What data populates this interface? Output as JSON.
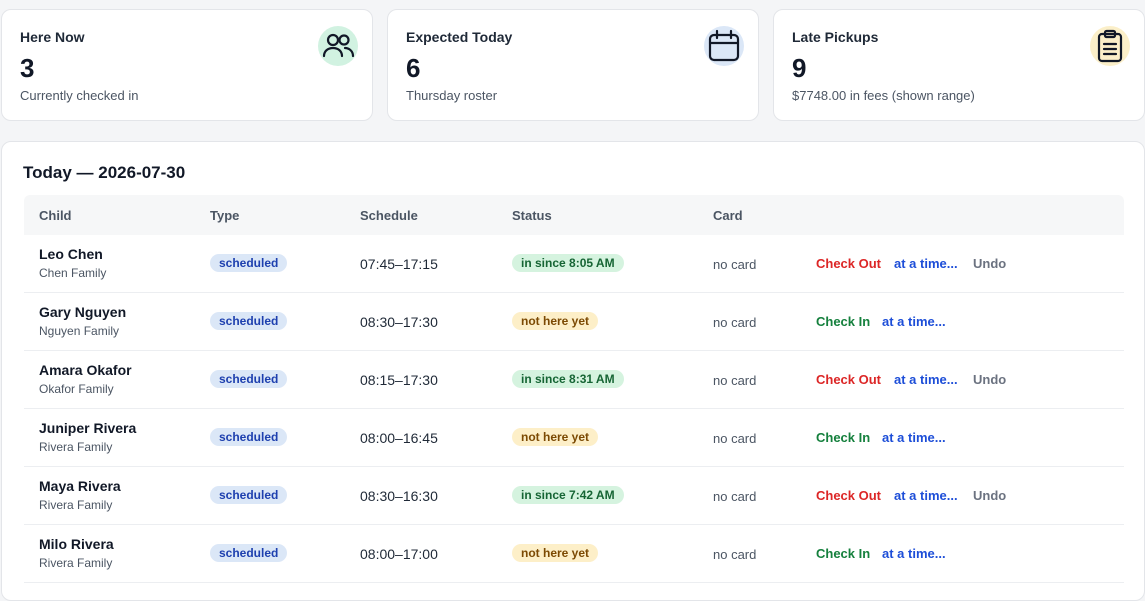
{
  "stats": [
    {
      "title": "Here Now",
      "value": "3",
      "subtitle": "Currently checked in",
      "icon": "people-icon",
      "icon_bg": "#d1f2e1"
    },
    {
      "title": "Expected Today",
      "value": "6",
      "subtitle": "Thursday roster",
      "icon": "calendar-icon",
      "icon_bg": "#dbe7f7"
    },
    {
      "title": "Late Pickups",
      "value": "9",
      "subtitle": "$7748.00 in fees (shown range)",
      "icon": "clipboard-icon",
      "icon_bg": "#fbefc9"
    }
  ],
  "panel": {
    "title": "Today — 2026-07-30",
    "columns": [
      "Child",
      "Type",
      "Schedule",
      "Status",
      "Card"
    ]
  },
  "rows": [
    {
      "name": "Leo Chen",
      "family": "Chen Family",
      "type": "scheduled",
      "schedule": "07:45–17:15",
      "status": "in since 8:05 AM",
      "status_kind": "in",
      "card": "no card",
      "primary_action": "Check Out",
      "action_kind": "checkout",
      "time_action": "at a time...",
      "undo": "Undo"
    },
    {
      "name": "Gary Nguyen",
      "family": "Nguyen Family",
      "type": "scheduled",
      "schedule": "08:30–17:30",
      "status": "not here yet",
      "status_kind": "out",
      "card": "no card",
      "primary_action": "Check In",
      "action_kind": "checkin",
      "time_action": "at a time...",
      "undo": ""
    },
    {
      "name": "Amara Okafor",
      "family": "Okafor Family",
      "type": "scheduled",
      "schedule": "08:15–17:30",
      "status": "in since 8:31 AM",
      "status_kind": "in",
      "card": "no card",
      "primary_action": "Check Out",
      "action_kind": "checkout",
      "time_action": "at a time...",
      "undo": "Undo"
    },
    {
      "name": "Juniper Rivera",
      "family": "Rivera Family",
      "type": "scheduled",
      "schedule": "08:00–16:45",
      "status": "not here yet",
      "status_kind": "out",
      "card": "no card",
      "primary_action": "Check In",
      "action_kind": "checkin",
      "time_action": "at a time...",
      "undo": ""
    },
    {
      "name": "Maya Rivera",
      "family": "Rivera Family",
      "type": "scheduled",
      "schedule": "08:30–16:30",
      "status": "in since 7:42 AM",
      "status_kind": "in",
      "card": "no card",
      "primary_action": "Check Out",
      "action_kind": "checkout",
      "time_action": "at a time...",
      "undo": "Undo"
    },
    {
      "name": "Milo Rivera",
      "family": "Rivera Family",
      "type": "scheduled",
      "schedule": "08:00–17:00",
      "status": "not here yet",
      "status_kind": "out",
      "card": "no card",
      "primary_action": "Check In",
      "action_kind": "checkin",
      "time_action": "at a time...",
      "undo": ""
    }
  ]
}
